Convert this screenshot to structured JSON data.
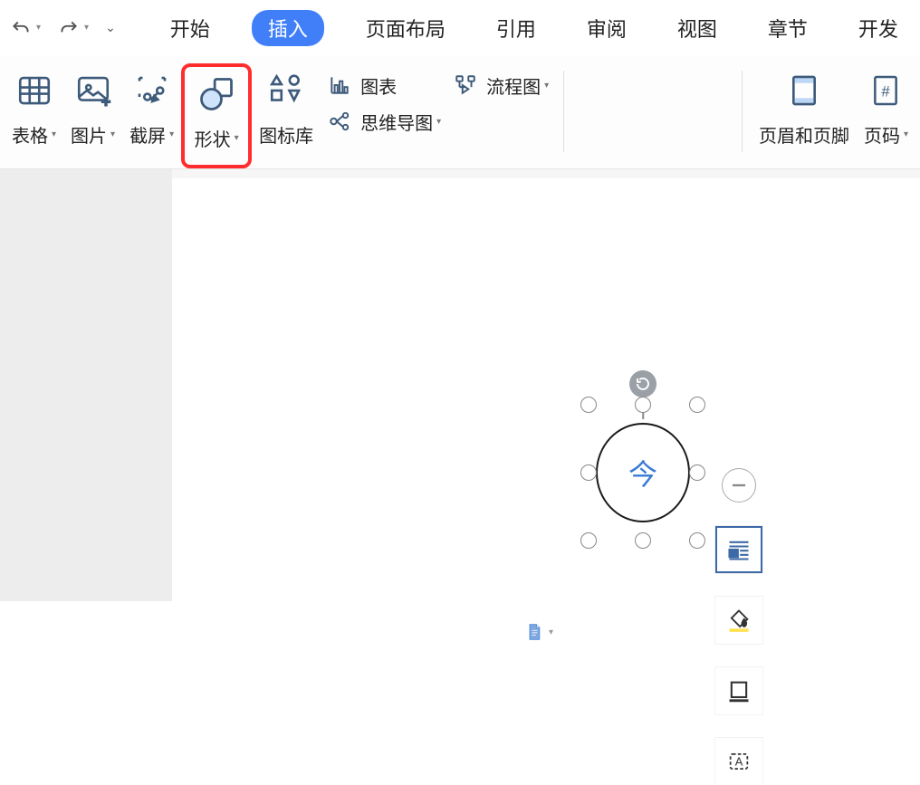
{
  "qat": {
    "undo_icon": "undo",
    "redo_icon": "redo",
    "customize_icon": "customize"
  },
  "tabs": {
    "start": "开始",
    "insert": "插入",
    "pageLayout": "页面布局",
    "references": "引用",
    "review": "审阅",
    "view": "视图",
    "chapters": "章节",
    "developer": "开发"
  },
  "ribbon": {
    "table": "表格",
    "picture": "图片",
    "screenshot": "截屏",
    "shapes": "形状",
    "iconLib": "图标库",
    "chart": "图表",
    "mindmap": "思维导图",
    "flowchart": "流程图",
    "headerFooter": "页眉和页脚",
    "pageNumber": "页码"
  },
  "canvas": {
    "shapeText": "今"
  }
}
